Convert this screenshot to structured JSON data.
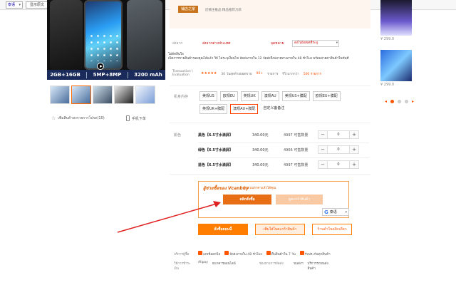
{
  "topbar": {
    "lang_select": "泰语",
    "show_original_btn": "显示原文"
  },
  "product": {
    "specs": [
      "2GB+16GB",
      "5MP+8MP",
      "3200 mAh"
    ],
    "favorite_label": "เพิ่มสินค้าลงรายการโปรด(10)",
    "mobile_order_label": "手机下单"
  },
  "shop": {
    "badge": "铺店之家",
    "tags": "店铺主推品  精品推荐力款"
  },
  "shipping": {
    "label": "ส่งจาก",
    "location": "ส่งจากต่างประเทศ",
    "to_label": "จุดหมาย",
    "to_value": "ส่งไปยังเขตที่ระบุ"
  },
  "transaction": {
    "label": "Transaction \\ Evaluation",
    "line1": "ไม่ตัดสินใจ",
    "line2": "เปิดการขายสินค้าของคุณได้แล้ว วิธี   ไม่ระบุเงื่อนไข   จัดส่งภายใน 12   จัดส่งถึงปลายทางภายใน 48 ชั่วโมง พร้อมจ่ายค่าสินค้าในทันที",
    "stars": "★★★★★",
    "eval_text": "30 วันสุดท้ายยอดขาย",
    "eval_count": "90+",
    "eval_unit": "รายการ",
    "review_label": "รีวิวมากกว่า",
    "review_count": "500 รายการ"
  },
  "model": {
    "label": "机身内存",
    "options": [
      "美规US",
      "欧规EU",
      "英规UK",
      "澳规AU",
      "美规US+膜配",
      "欧规EU+膜配",
      "英规UK+膜配",
      "澳规AU+膜配",
      "自定义备备注"
    ]
  },
  "color": {
    "label": "颜色",
    "rows": [
      {
        "name": "黑色【6.5寸水滴屏】",
        "price": "340.00元",
        "stock": "4997 可售数量",
        "qty": "0"
      },
      {
        "name": "绿色【6.5寸水滴屏】",
        "price": "340.00元",
        "stock": "4966 可售数量",
        "qty": "0"
      },
      {
        "name": "蓝色【6.5寸水滴屏】",
        "price": "340.00元",
        "stock": "4997 可售数量",
        "qty": "0"
      }
    ]
  },
  "vcanbuy": {
    "title": "ผู้ช่วยซื้อของ Vcanbuy",
    "subtitle": "คำนวณราคาแล้วได้คุณ",
    "primary_btn": "คลิกสั่งซื้อ",
    "secondary_btn": "ดูตะกร้าสินค้า",
    "translate_lang": "泰语"
  },
  "actions": {
    "buy_now": "สั่งซื้อตอนนี้",
    "add_cart": "เพิ่มใส่ในตะกร้าสินค้า",
    "enter_store": "ร้านค้าในคลิกเดียว"
  },
  "service": {
    "label": "บริการผู้ซื้อ",
    "items": [
      "เลขที่ออกบิล",
      "จัดส่งภายใน 48 ชั่วโมง",
      "คืนสินค้าใน 7 วัน",
      "รับประกันทุกสินค้า"
    ]
  },
  "payment": {
    "label": "วิธีการชำระเงิน",
    "method": "Alipay",
    "method2": "ธนาคารออนไลน์",
    "ship_label": "ช่องทางการจัดส่ง",
    "ship_value": "ขนส่งฯ",
    "ship_extra": "บริการรถขนส่งสินค้า"
  },
  "recommend": [
    {
      "price": "¥ 299.0"
    },
    {
      "price": "¥ 299.0"
    }
  ],
  "colors": {
    "accent": "#ff7e00",
    "star": "#ff5500",
    "arrow": "#e02020"
  }
}
